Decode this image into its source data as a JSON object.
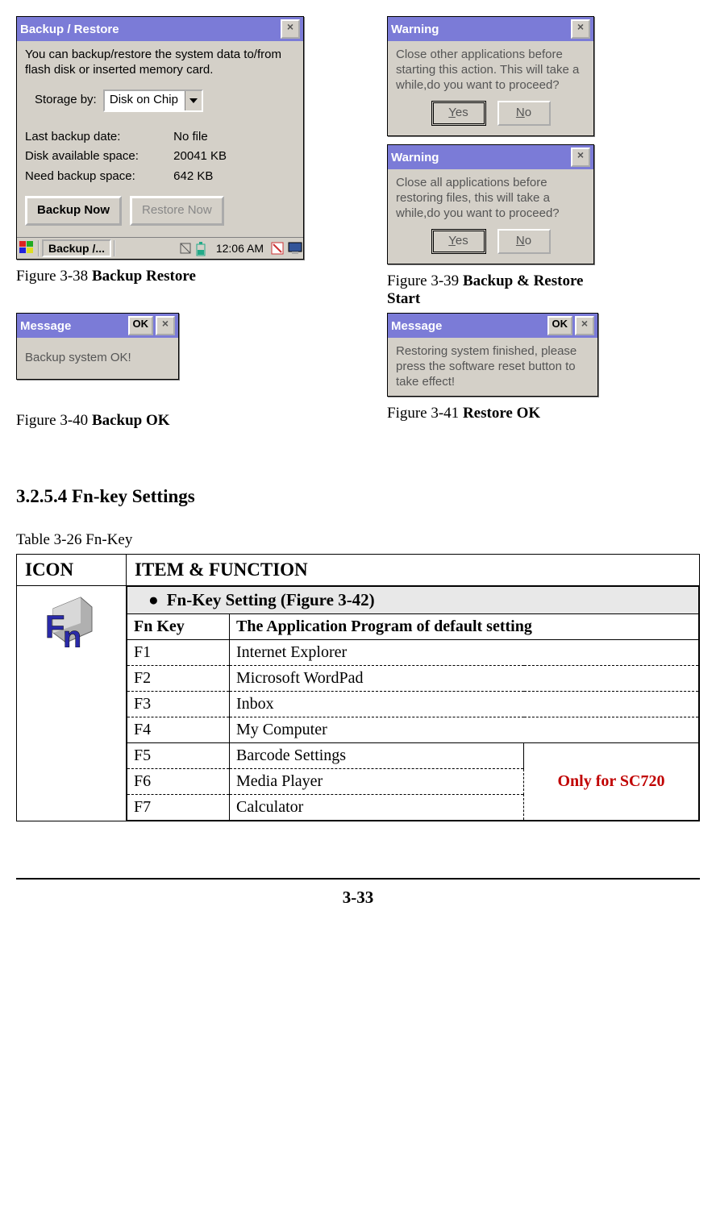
{
  "figures": {
    "f38": {
      "prefix": "Figure 3-38 ",
      "title": "Backup Restore"
    },
    "f39": {
      "prefix": "Figure 3-39 ",
      "title": "Backup & Restore Start"
    },
    "f40": {
      "prefix": "Figure 3-40 ",
      "title": "Backup OK"
    },
    "f41": {
      "prefix": "Figure 3-41 ",
      "title": "Restore OK"
    }
  },
  "backup_restore": {
    "title": "Backup / Restore",
    "close": "×",
    "intro": "You can backup/restore the system data to/from flash disk or inserted memory card.",
    "storage_label": "Storage by:",
    "storage_value": "Disk on Chip",
    "last_backup_label": "Last backup date:",
    "last_backup_value": "No file",
    "avail_label": "Disk available space:",
    "avail_value": "20041 KB",
    "need_label": "Need backup space:",
    "need_value": "642 KB",
    "backup_btn": "Backup Now",
    "restore_btn": "Restore Now",
    "task_label": "Backup /...",
    "time": "12:06 AM"
  },
  "warning1": {
    "title": "Warning",
    "text": "Close other applications before starting this action. This will take a while,do you want to proceed?",
    "yes": "Yes",
    "no": "No"
  },
  "warning2": {
    "title": "Warning",
    "text": "Close all applications before restoring files, this will take a while,do you want to proceed?",
    "yes": "Yes",
    "no": "No"
  },
  "msg_ok": {
    "title": "Message",
    "ok": "OK",
    "text": "Backup system OK!"
  },
  "msg_restore": {
    "title": "Message",
    "ok": "OK",
    "text": "Restoring system finished, please press the software reset button to take effect!"
  },
  "section_heading": "3.2.5.4 Fn-key Settings",
  "table_label_prefix": "Table 3-26 ",
  "table_label_bold": "Fn-Key",
  "table": {
    "h_icon": "ICON",
    "h_item": "ITEM & FUNCTION",
    "setting_title": "Fn-Key Setting (Figure 3-42)",
    "sub_key": "Fn Key",
    "sub_app": "The Application Program of default setting",
    "rows": [
      {
        "k": "F1",
        "v": "Internet Explorer"
      },
      {
        "k": "F2",
        "v": "Microsoft WordPad"
      },
      {
        "k": "F3",
        "v": "Inbox"
      },
      {
        "k": "F4",
        "v": "My Computer"
      },
      {
        "k": "F5",
        "v": "Barcode Settings"
      },
      {
        "k": "F6",
        "v": "Media Player"
      },
      {
        "k": "F7",
        "v": "Calculator"
      }
    ],
    "note": "Only for SC720"
  },
  "page_number": "3-33"
}
